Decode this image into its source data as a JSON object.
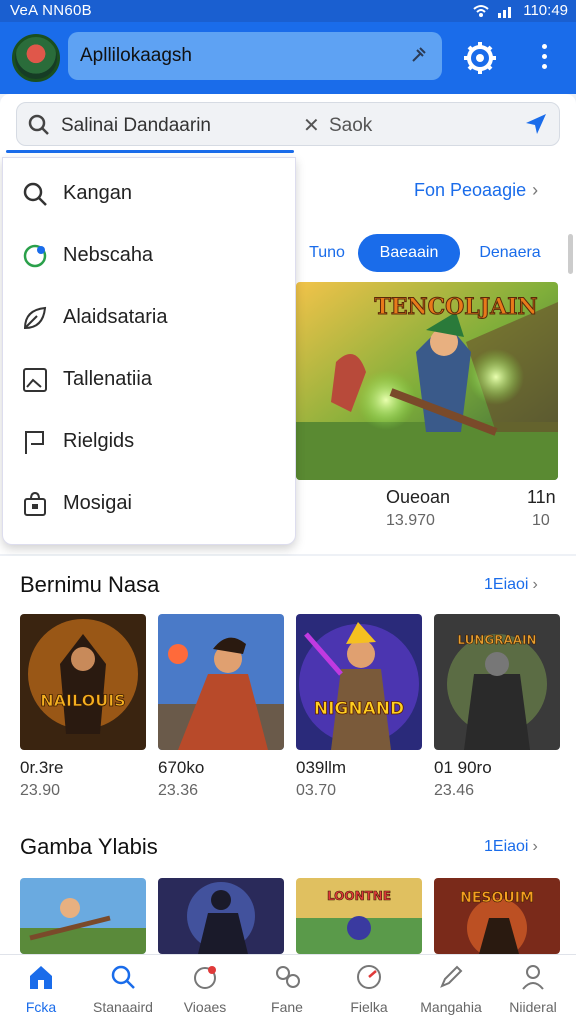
{
  "status_bar": {
    "left_text": "VeA NN60B",
    "time": "110:49"
  },
  "app_bar": {
    "search_text": "Apllilokaagsh"
  },
  "search": {
    "query": "Salinai Dandaarin",
    "secondary": "Saok"
  },
  "dropdown_menu": {
    "items": [
      {
        "label": "Kangan",
        "icon": "search-icon"
      },
      {
        "label": "Nebscaha",
        "icon": "chat-icon"
      },
      {
        "label": "Alaidsataria",
        "icon": "leaf-icon"
      },
      {
        "label": "Tallenatiia",
        "icon": "picture-icon"
      },
      {
        "label": "Rielgids",
        "icon": "flag-icon"
      },
      {
        "label": "Mosigai",
        "icon": "bag-icon"
      }
    ],
    "link": "Fon Peoaagie"
  },
  "tabs": [
    {
      "label": "Tuno",
      "active": false
    },
    {
      "label": "Baeaain",
      "active": true
    },
    {
      "label": "Denaera",
      "active": false
    }
  ],
  "featured": {
    "title": "Oueoan",
    "subtitle": "13.970",
    "right_title": "11n",
    "right_subtitle": "10",
    "banner_text": "TENCOLJAIN"
  },
  "sections": [
    {
      "title": "Bernimu Nasa",
      "more": "1Eiaoi",
      "cards": [
        {
          "title": "0r.3re",
          "subtitle": "23.90",
          "art_text": "NAILOUIS"
        },
        {
          "title": "670ko",
          "subtitle": "23.36",
          "art_text": ""
        },
        {
          "title": "039llm",
          "subtitle": "03.70",
          "art_text": "NIGNAND"
        },
        {
          "title": "01 90ro",
          "subtitle": "23.46",
          "art_text": "LUNGRAAIN"
        }
      ]
    },
    {
      "title": "Gamba Ylabis",
      "more": "1Eiaoi",
      "cards": [
        {
          "title": "",
          "subtitle": "",
          "art_text": ""
        },
        {
          "title": "",
          "subtitle": "",
          "art_text": ""
        },
        {
          "title": "",
          "subtitle": "",
          "art_text": "LOONTNE"
        },
        {
          "title": "",
          "subtitle": "",
          "art_text": "NESOUIM"
        }
      ]
    }
  ],
  "bottom_nav": [
    {
      "label": "Fcka",
      "icon": "home-icon",
      "active": true
    },
    {
      "label": "Stanaaird",
      "icon": "search-icon",
      "active": false
    },
    {
      "label": "Vioaes",
      "icon": "chat-icon",
      "active": false
    },
    {
      "label": "Fane",
      "icon": "people-icon",
      "active": false
    },
    {
      "label": "Fielka",
      "icon": "gauge-icon",
      "active": false
    },
    {
      "label": "Mangahia",
      "icon": "pen-icon",
      "active": false
    },
    {
      "label": "Niideral",
      "icon": "person-icon",
      "active": false
    }
  ],
  "colors": {
    "accent": "#1a6cea",
    "status_bar": "#1a5fd0"
  }
}
